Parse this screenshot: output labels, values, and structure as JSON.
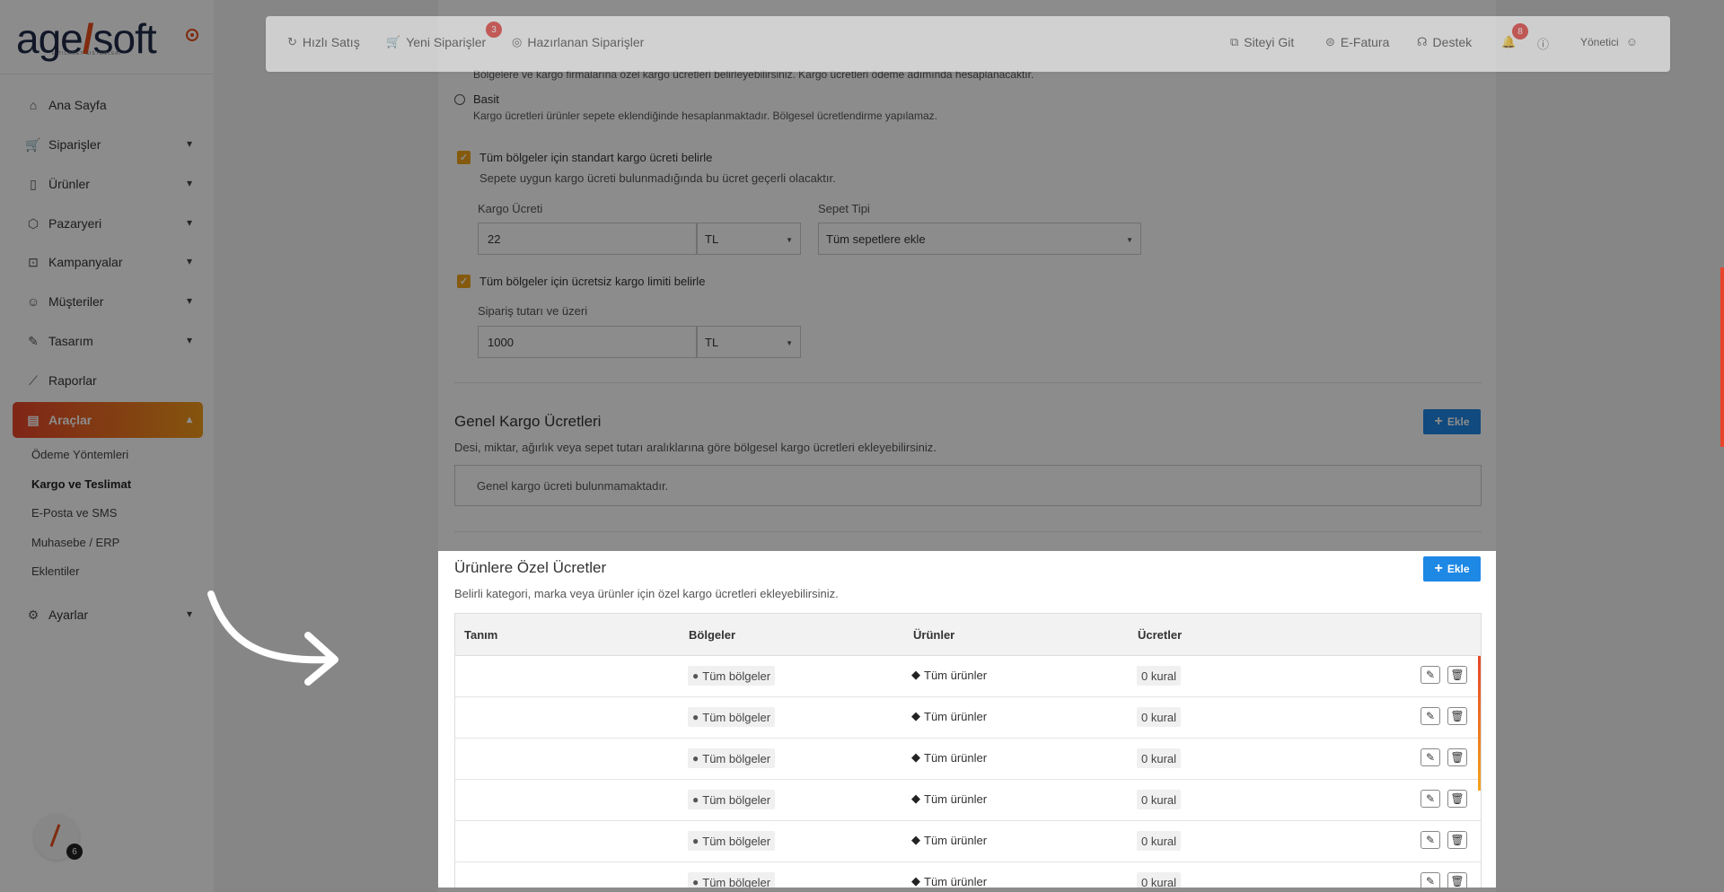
{
  "sidebar": {
    "logo_text_a": "age",
    "logo_slash": "/",
    "logo_text_b": "soft",
    "logo_subtitle": "E-TICARET SISTEMLERI",
    "items": [
      {
        "label": "Ana Sayfa",
        "icon": "home-icon"
      },
      {
        "label": "Siparişler",
        "icon": "cart-icon"
      },
      {
        "label": "Ürünler",
        "icon": "book-icon"
      },
      {
        "label": "Pazaryeri",
        "icon": "box-icon"
      },
      {
        "label": "Kampanyalar",
        "icon": "basket-icon"
      },
      {
        "label": "Müşteriler",
        "icon": "user-icon"
      },
      {
        "label": "Tasarım",
        "icon": "pen-icon"
      },
      {
        "label": "Raporlar",
        "icon": "chart-icon"
      },
      {
        "label": "Araçlar",
        "icon": "clipboard-icon"
      },
      {
        "label": "Ayarlar",
        "icon": "gear-icon"
      }
    ],
    "sub_items": [
      "Ödeme Yöntemleri",
      "Kargo ve Teslimat",
      "E-Posta ve SMS",
      "Muhasebe / ERP",
      "Eklentiler"
    ],
    "avatar_badge": "6"
  },
  "topbar": {
    "hizli_satis": "Hızlı Satış",
    "yeni_siparisler": "Yeni Siparişler",
    "yeni_siparisler_badge": "3",
    "hazirlanan": "Hazırlanan Siparişler",
    "siteyi_git": "Siteyi Git",
    "efatura": "E-Fatura",
    "destek": "Destek",
    "notif_badge": "8",
    "user": "Yönetici"
  },
  "shipping": {
    "bolgesel_desc": "Bölgelere ve kargo firmalarına özel kargo ücretleri belirleyebilirsiniz. Kargo ücretleri ödeme adımında hesaplanacaktır.",
    "basit_label": "Basit",
    "basit_desc": "Kargo ücretleri ürünler sepete eklendiğinde hesaplanmaktadır. Bölgesel ücretlendirme yapılamaz.",
    "standard_check": "Tüm bölgeler için standart kargo ücreti belirle",
    "standard_desc": "Sepete uygun kargo ücreti bulunmadığında bu ücret geçerli olacaktır.",
    "kargo_ucreti_label": "Kargo Ücreti",
    "kargo_ucreti_value": "22",
    "currency": "TL",
    "sepet_tipi_label": "Sepet Tipi",
    "sepet_tipi_value": "Tüm sepetlere ekle",
    "free_check": "Tüm bölgeler için ücretsiz kargo limiti belirle",
    "siparis_tutari_label": "Sipariş tutarı ve üzeri",
    "siparis_tutari_value": "1000",
    "currency2": "TL"
  },
  "genel": {
    "title": "Genel Kargo Ücretleri",
    "desc": "Desi, miktar, ağırlık veya sepet tutarı aralıklarına göre bölgesel kargo ücretleri ekleyebilirsiniz.",
    "empty": "Genel kargo ücreti bulunmamaktadır.",
    "add_label": "Ekle"
  },
  "ozel": {
    "title": "Ürünlere Özel Ücretler",
    "desc": "Belirli kategori, marka veya ürünler için özel kargo ücretleri ekleyebilirsiniz.",
    "add_label": "Ekle",
    "columns": [
      "Tanım",
      "Bölgeler",
      "Ürünler",
      "Ücretler"
    ],
    "rows": [
      {
        "tanim": "",
        "bolgeler": "Tüm bölgeler",
        "urunler": "Tüm ürünler",
        "ucretler": "0 kural"
      },
      {
        "tanim": "",
        "bolgeler": "Tüm bölgeler",
        "urunler": "Tüm ürünler",
        "ucretler": "0 kural"
      },
      {
        "tanim": "",
        "bolgeler": "Tüm bölgeler",
        "urunler": "Tüm ürünler",
        "ucretler": "0 kural"
      },
      {
        "tanim": "",
        "bolgeler": "Tüm bölgeler",
        "urunler": "Tüm ürünler",
        "ucretler": "0 kural"
      },
      {
        "tanim": "",
        "bolgeler": "Tüm bölgeler",
        "urunler": "Tüm ürünler",
        "ucretler": "0 kural"
      },
      {
        "tanim": "",
        "bolgeler": "Tüm bölgeler",
        "urunler": "Tüm ürünler",
        "ucretler": "0 kural"
      }
    ]
  },
  "colors": {
    "accent": "#e94e1b",
    "brand_blue": "#1e88e5",
    "check": "#f2a41b"
  }
}
